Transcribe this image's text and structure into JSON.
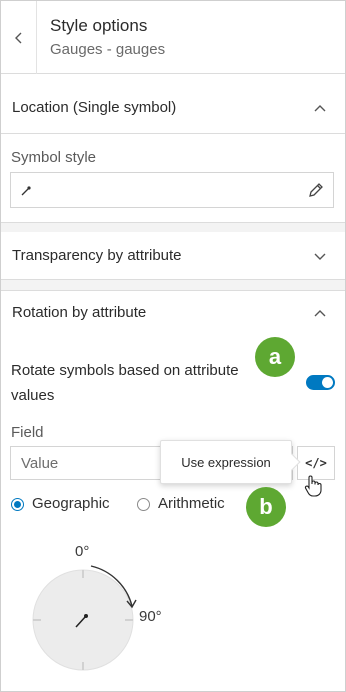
{
  "header": {
    "title": "Style options",
    "subtitle": "Gauges - gauges"
  },
  "location": {
    "title": "Location (Single symbol)",
    "symbol_style_label": "Symbol style"
  },
  "transparency": {
    "title": "Transparency by attribute"
  },
  "rotation": {
    "title": "Rotation by attribute",
    "rotate_text": "Rotate symbols based on attribute values",
    "toggle_on": true,
    "field_label": "Field",
    "field_placeholder": "Value",
    "tooltip": "Use expression",
    "expression_icon_text": "</>",
    "options": [
      {
        "label": "Geographic",
        "selected": true
      },
      {
        "label": "Arithmetic",
        "selected": false
      }
    ],
    "dial_top_label": "0°",
    "dial_right_label": "90°"
  },
  "callouts": {
    "a": "a",
    "b": "b"
  },
  "colors": {
    "accent": "#0079c1",
    "callout": "#5ea832",
    "band": "#f3f3f3"
  },
  "icons": [
    "chevron-left-icon",
    "chevron-up-icon",
    "chevron-down-icon",
    "pencil-icon",
    "symbol-arrow-icon",
    "code-icon",
    "hand-cursor-icon"
  ]
}
